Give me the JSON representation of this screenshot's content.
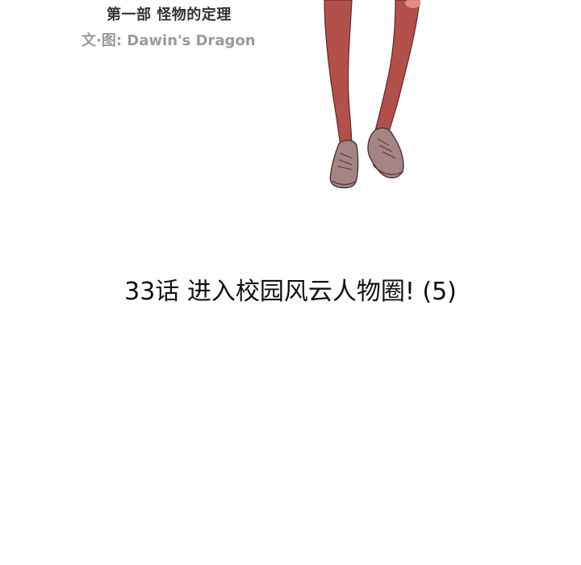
{
  "header": {
    "part_title": "第一部 怪物的定理",
    "credit": "文·图: Dawin's Dragon"
  },
  "illustration": {
    "subject": "legs-with-sneakers",
    "leg_color": "#b4504a",
    "shoe_color": "#a58484"
  },
  "chapter": {
    "title": "33话 进入校园风云人物圈! (5)"
  }
}
